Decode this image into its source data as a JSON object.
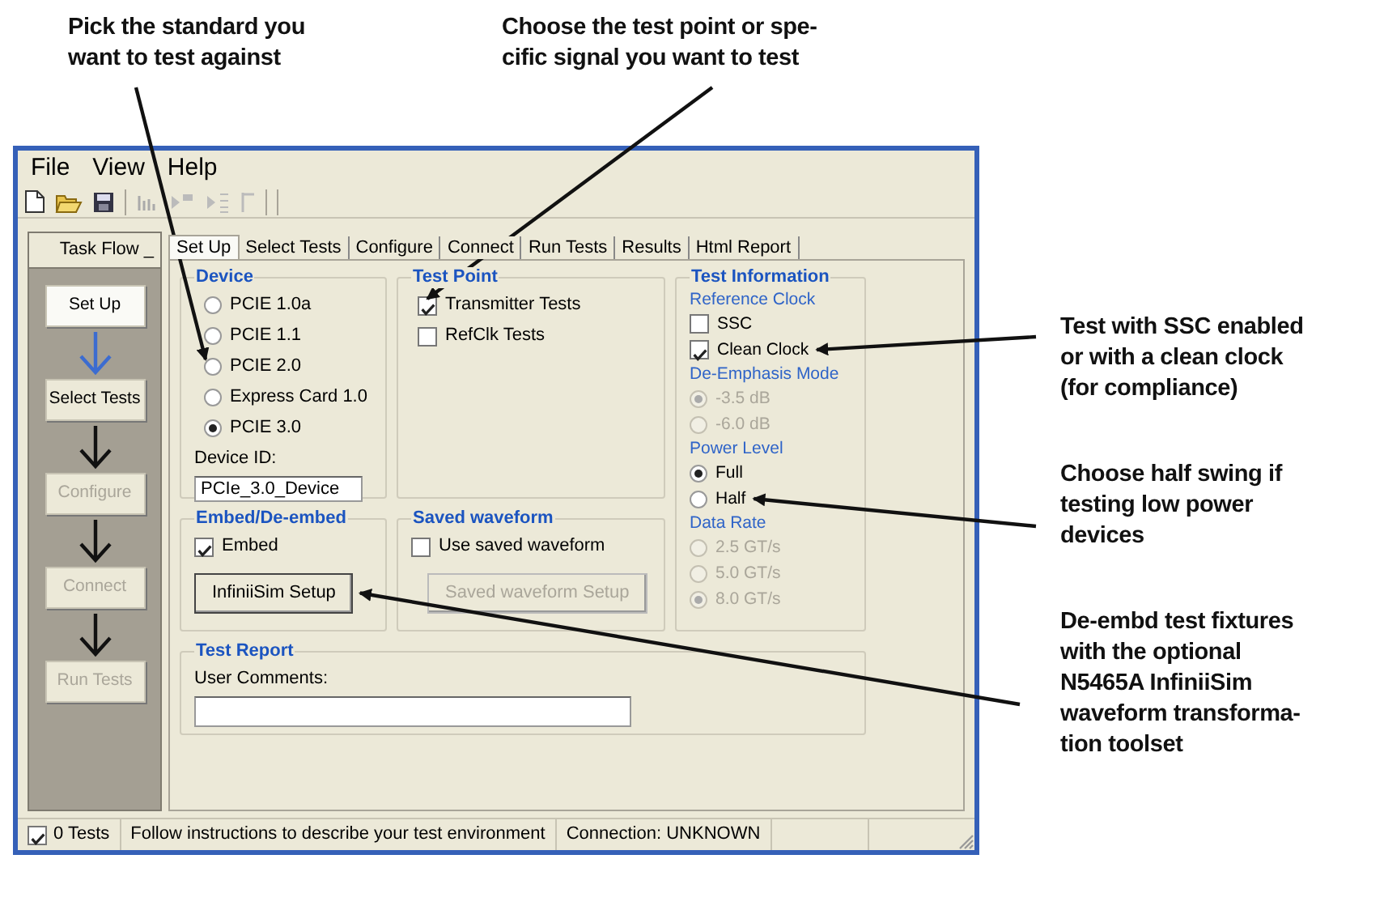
{
  "callouts": [
    {
      "lines": [
        "Pick the standard you",
        "want to test against"
      ]
    },
    {
      "lines": [
        "Choose the test point or spe-",
        "cific signal you want to test"
      ]
    },
    {
      "lines": [
        "Test with SSC enabled",
        "or with a clean clock",
        "(for compliance)"
      ]
    },
    {
      "lines": [
        "Choose half swing if",
        "testing low power",
        "devices"
      ]
    },
    {
      "lines": [
        "De-embd test fixtures",
        "with the optional",
        "N5465A InfiniiSim",
        "waveform transforma-",
        "tion toolset"
      ]
    }
  ],
  "window": {
    "menu": [
      "File",
      "View",
      "Help"
    ],
    "task_flow": {
      "title": "Task Flow",
      "minimize": "_",
      "steps": [
        {
          "label": "Set Up",
          "selected": true,
          "disabled": false
        },
        {
          "label": "Select Tests",
          "selected": false,
          "disabled": false
        },
        {
          "label": "Configure",
          "selected": false,
          "disabled": true
        },
        {
          "label": "Connect",
          "selected": false,
          "disabled": true
        },
        {
          "label": "Run Tests",
          "selected": false,
          "disabled": true
        }
      ]
    },
    "tabs": [
      {
        "label": "Set Up",
        "selected": true
      },
      {
        "label": "Select Tests",
        "selected": false
      },
      {
        "label": "Configure",
        "selected": false
      },
      {
        "label": "Connect",
        "selected": false
      },
      {
        "label": "Run Tests",
        "selected": false
      },
      {
        "label": "Results",
        "selected": false
      },
      {
        "label": "Html Report",
        "selected": false
      }
    ],
    "device": {
      "title": "Device",
      "options": [
        {
          "label": "PCIE 1.0a",
          "selected": false
        },
        {
          "label": "PCIE 1.1",
          "selected": false
        },
        {
          "label": "PCIE 2.0",
          "selected": false
        },
        {
          "label": "Express Card 1.0",
          "selected": false
        },
        {
          "label": "PCIE 3.0",
          "selected": true
        }
      ],
      "id_label": "Device ID:",
      "id_value": "PCIe_3.0_Device"
    },
    "test_point": {
      "title": "Test Point",
      "checks": [
        {
          "label": "Transmitter Tests",
          "checked": true
        },
        {
          "label": "RefClk Tests",
          "checked": false
        }
      ]
    },
    "test_information": {
      "title": "Test Information",
      "sections": [
        {
          "title": "Reference Clock",
          "kind": "check",
          "items": [
            {
              "label": "SSC",
              "checked": false,
              "disabled": false
            },
            {
              "label": "Clean Clock",
              "checked": true,
              "disabled": false
            }
          ]
        },
        {
          "title": "De-Emphasis Mode",
          "kind": "radio",
          "items": [
            {
              "label": "-3.5 dB",
              "selected": true,
              "disabled": true
            },
            {
              "label": "-6.0 dB",
              "selected": false,
              "disabled": true
            }
          ]
        },
        {
          "title": "Power Level",
          "kind": "radio",
          "items": [
            {
              "label": "Full",
              "selected": true,
              "disabled": false
            },
            {
              "label": "Half",
              "selected": false,
              "disabled": false
            }
          ]
        },
        {
          "title": "Data Rate",
          "kind": "radio",
          "items": [
            {
              "label": "2.5 GT/s",
              "selected": false,
              "disabled": true
            },
            {
              "label": "5.0 GT/s",
              "selected": false,
              "disabled": true
            },
            {
              "label": "8.0 GT/s",
              "selected": true,
              "disabled": true
            }
          ]
        }
      ]
    },
    "embed": {
      "title": "Embed/De-embed",
      "checkbox": {
        "label": "Embed",
        "checked": true
      },
      "button": {
        "label": "InfiniiSim Setup",
        "disabled": false
      }
    },
    "saved_waveform": {
      "title": "Saved waveform",
      "checkbox": {
        "label": "Use saved waveform",
        "checked": false
      },
      "button": {
        "label": "Saved waveform Setup",
        "disabled": true
      }
    },
    "test_report": {
      "title": "Test Report",
      "label": "User Comments:"
    },
    "status_bar": {
      "tests": {
        "label": "0 Tests",
        "checked": true
      },
      "message": "Follow instructions to describe your test environment",
      "connection": "Connection: UNKNOWN"
    }
  }
}
